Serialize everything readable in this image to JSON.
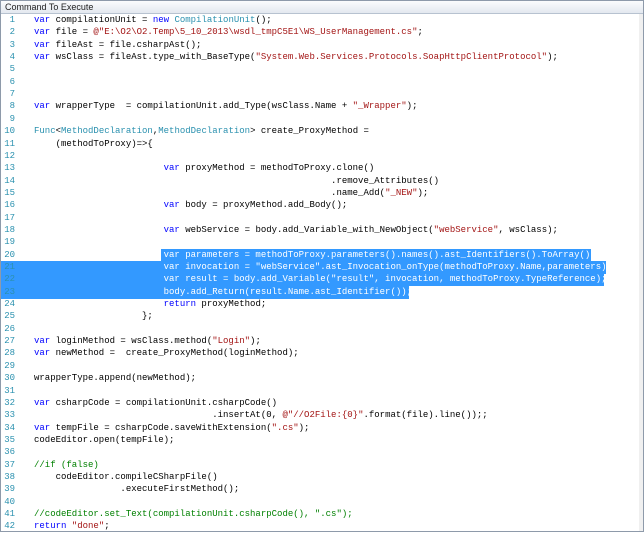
{
  "window": {
    "title": "Command To Execute"
  },
  "editor": {
    "lines": [
      {
        "n": "1",
        "text": "var compilationUnit = new CompilationUnit();"
      },
      {
        "n": "2",
        "text": "var file = @\"E:\\O2\\O2.Temp\\5_10_2013\\wsdl_tmpC5E1\\WS_UserManagement.cs\";"
      },
      {
        "n": "3",
        "text": "var fileAst = file.csharpAst();"
      },
      {
        "n": "4",
        "text": "var wsClass = fileAst.type_with_BaseType(\"System.Web.Services.Protocols.SoapHttpClientProtocol\");"
      },
      {
        "n": "5",
        "text": ""
      },
      {
        "n": "6",
        "text": ""
      },
      {
        "n": "7",
        "text": ""
      },
      {
        "n": "8",
        "text": "var wrapperType  = compilationUnit.add_Type(wsClass.Name + \"_Wrapper\");"
      },
      {
        "n": "9",
        "text": ""
      },
      {
        "n": "10",
        "text": "Func<MethodDeclaration,MethodDeclaration> create_ProxyMethod ="
      },
      {
        "n": "11",
        "text": "    (methodToProxy)=>{"
      },
      {
        "n": "12",
        "text": ""
      },
      {
        "n": "13",
        "text": "                        var proxyMethod = methodToProxy.clone()"
      },
      {
        "n": "14",
        "text": "                                                       .remove_Attributes()"
      },
      {
        "n": "15",
        "text": "                                                       .name_Add(\"_NEW\");"
      },
      {
        "n": "16",
        "text": "                        var body = proxyMethod.add_Body();"
      },
      {
        "n": "17",
        "text": ""
      },
      {
        "n": "18",
        "text": "                        var webService = body.add_Variable_with_NewObject(\"webService\", wsClass);"
      },
      {
        "n": "19",
        "text": ""
      },
      {
        "n": "20",
        "text": "                        var parameters = methodToProxy.parameters().names().ast_Identifiers().ToArray();"
      },
      {
        "n": "21",
        "text": "                        var invocation = \"webService\".ast_Invocation_onType(methodToProxy.Name,parameters);"
      },
      {
        "n": "22",
        "text": "                        var result = body.add_Variable(\"result\", invocation, methodToProxy.TypeReference);"
      },
      {
        "n": "23",
        "text": "                        body.add_Return(result.Name.ast_Identifier());"
      },
      {
        "n": "24",
        "text": "                        return proxyMethod;"
      },
      {
        "n": "25",
        "text": "                    };"
      },
      {
        "n": "26",
        "text": ""
      },
      {
        "n": "27",
        "text": "var loginMethod = wsClass.method(\"Login\");"
      },
      {
        "n": "28",
        "text": "var newMethod =  create_ProxyMethod(loginMethod);"
      },
      {
        "n": "29",
        "text": ""
      },
      {
        "n": "30",
        "text": "wrapperType.append(newMethod);"
      },
      {
        "n": "31",
        "text": ""
      },
      {
        "n": "32",
        "text": "var csharpCode = compilationUnit.csharpCode()"
      },
      {
        "n": "33",
        "text": "                                 .insertAt(0, @\"//O2File:{0}\".format(file).line());;"
      },
      {
        "n": "34",
        "text": "var tempFile = csharpCode.saveWithExtension(\".cs\");"
      },
      {
        "n": "35",
        "text": "codeEditor.open(tempFile);"
      },
      {
        "n": "36",
        "text": ""
      },
      {
        "n": "37",
        "text": "//if (false)"
      },
      {
        "n": "38",
        "text": "    codeEditor.compileCSharpFile()"
      },
      {
        "n": "39",
        "text": "                .executeFirstMethod();"
      },
      {
        "n": "40",
        "text": ""
      },
      {
        "n": "41",
        "text": "//codeEditor.set_Text(compilationUnit.csharpCode(), \".cs\");"
      },
      {
        "n": "42",
        "text": "return \"done\";"
      }
    ]
  }
}
